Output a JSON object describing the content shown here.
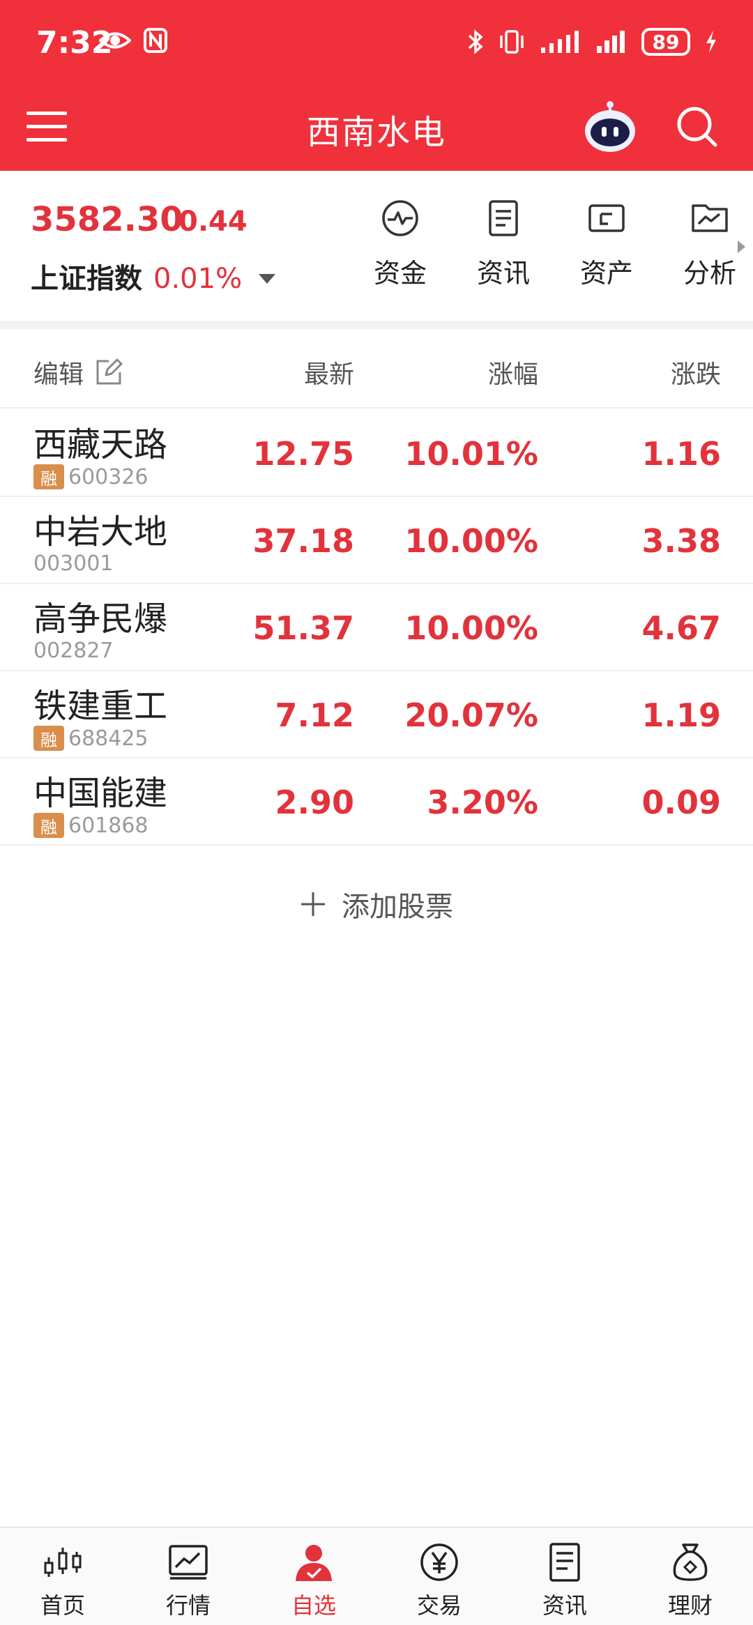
{
  "status_bar": {
    "time": "7:32",
    "battery": "89"
  },
  "header": {
    "title": "西南水电"
  },
  "index": {
    "value": "3582.30",
    "change": "0.44",
    "name": "上证指数",
    "pct": "0.01%"
  },
  "tools": [
    {
      "label": "资金",
      "icon": "pulse-icon"
    },
    {
      "label": "资讯",
      "icon": "document-icon"
    },
    {
      "label": "资产",
      "icon": "wallet-icon"
    },
    {
      "label": "分析",
      "icon": "chart-folder-icon"
    }
  ],
  "table": {
    "edit_label": "编辑",
    "columns": {
      "latest": "最新",
      "pct": "涨幅",
      "change": "涨跌"
    },
    "rows": [
      {
        "name": "西藏天路",
        "margin_tag": "融",
        "code": "600326",
        "latest": "12.75",
        "pct": "10.01%",
        "change": "1.16"
      },
      {
        "name": "中岩大地",
        "margin_tag": "",
        "code": "003001",
        "latest": "37.18",
        "pct": "10.00%",
        "change": "3.38"
      },
      {
        "name": "高争民爆",
        "margin_tag": "",
        "code": "002827",
        "latest": "51.37",
        "pct": "10.00%",
        "change": "4.67"
      },
      {
        "name": "铁建重工",
        "margin_tag": "融",
        "code": "688425",
        "latest": "7.12",
        "pct": "20.07%",
        "change": "1.19"
      },
      {
        "name": "中国能建",
        "margin_tag": "融",
        "code": "601868",
        "latest": "2.90",
        "pct": "3.20%",
        "change": "0.09"
      }
    ]
  },
  "add_stock_label": "添加股票",
  "bottom_nav": [
    {
      "label": "首页",
      "icon": "candlestick-icon"
    },
    {
      "label": "行情",
      "icon": "line-chart-icon"
    },
    {
      "label": "自选",
      "icon": "user-check-icon"
    },
    {
      "label": "交易",
      "icon": "yen-icon"
    },
    {
      "label": "资讯",
      "icon": "news-icon"
    },
    {
      "label": "理财",
      "icon": "money-bag-icon"
    }
  ],
  "colors": {
    "brand_red": "#f0303a",
    "up_red": "#e2323b",
    "margin_tag": "#d98e4c"
  }
}
